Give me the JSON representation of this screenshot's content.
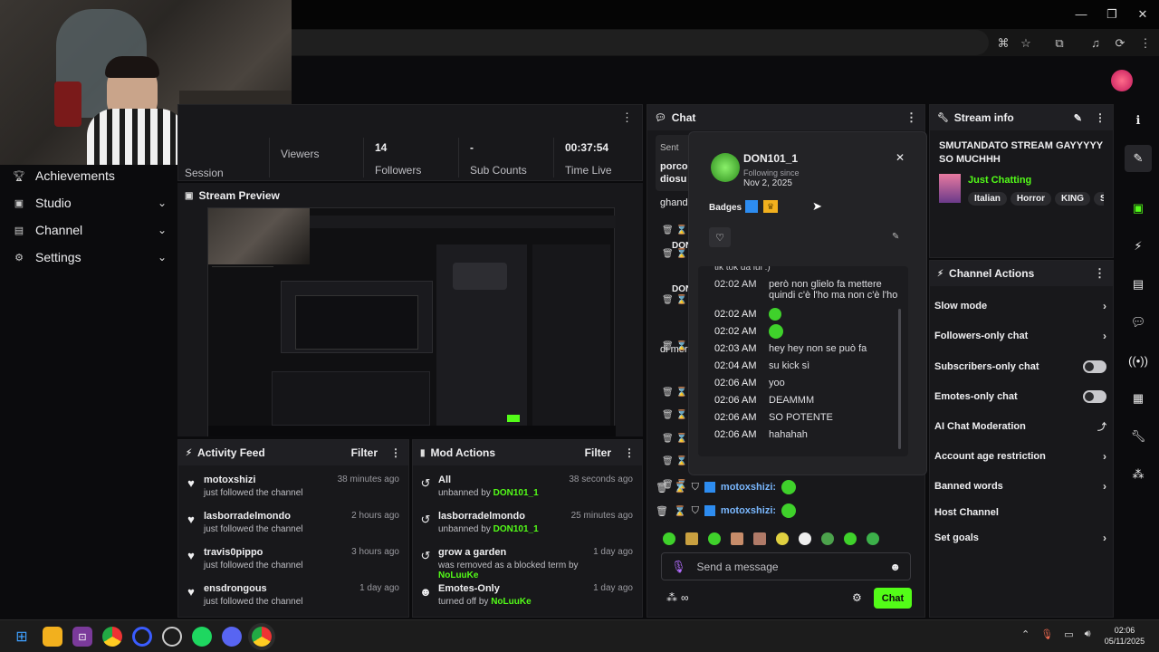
{
  "window": {
    "minimize": "—",
    "maximize": "❐",
    "close": "✕"
  },
  "toolbar_icons": [
    "translate-icon",
    "star-icon",
    "extensions-icon",
    "media-icon",
    "profile-sync-icon",
    "more-icon"
  ],
  "nav": {
    "items": [
      {
        "label": "Achievements",
        "icon": "trophy-icon"
      },
      {
        "label": "Studio",
        "icon": "studio-icon"
      },
      {
        "label": "Channel",
        "icon": "channel-icon"
      },
      {
        "label": "Settings",
        "icon": "gear-icon"
      }
    ]
  },
  "session": {
    "label": "Session",
    "stats": [
      {
        "value": "",
        "label": "Viewers"
      },
      {
        "value": "14",
        "label": "Followers"
      },
      {
        "value": "-",
        "label": "Sub Counts"
      },
      {
        "value": "00:37:54",
        "label": "Time Live"
      }
    ]
  },
  "preview": {
    "title": "Stream Preview"
  },
  "activity": {
    "title": "Activity Feed",
    "filter": "Filter",
    "items": [
      {
        "user": "motoxshizi",
        "text": "just followed the channel",
        "time": "38 minutes ago"
      },
      {
        "user": "lasborradelmondo",
        "text": "just followed the channel",
        "time": "2 hours ago"
      },
      {
        "user": "travis0pippo",
        "text": "just followed the channel",
        "time": "3 hours ago"
      },
      {
        "user": "ensdrongous",
        "text": "just followed the channel",
        "time": "1 day ago"
      }
    ]
  },
  "modactions": {
    "title": "Mod Actions",
    "filter": "Filter",
    "items": [
      {
        "target": "All",
        "action": "unbanned by ",
        "by": "DON101_1",
        "time": "38 seconds ago"
      },
      {
        "target": "lasborradelmondo",
        "action": "unbanned by ",
        "by": "DON101_1",
        "time": "25 minutes ago"
      },
      {
        "target": "grow a garden",
        "action": "was removed as a blocked term by ",
        "by": "NoLuuKe",
        "time": "1 day ago"
      },
      {
        "target": "Emotes-Only",
        "action": "turned off by ",
        "by": "NoLuuKe",
        "time": "1 day ago"
      }
    ]
  },
  "chat": {
    "title": "Chat",
    "partial": [
      "Sent",
      "porco",
      "diosu",
      "ghand",
      "DON",
      "DON",
      "di mer"
    ],
    "rows": [
      {
        "user": "motoxshizi:"
      },
      {
        "user": "motoxshizi:"
      }
    ],
    "input_placeholder": "Send a message",
    "send_label": "Chat",
    "infinity": "∞"
  },
  "popup": {
    "username": "DON101_1",
    "following_label": "Following since",
    "following_date": "Nov 2, 2025",
    "badges_label": "Badges",
    "partial_line": "tik tok da lui :)",
    "messages": [
      {
        "time": "02:02 AM",
        "text": "però non glielo fa mettere quindi c'è l'ho ma non c'è l'ho"
      },
      {
        "time": "02:02 AM",
        "text": ""
      },
      {
        "time": "02:02 AM",
        "text": ""
      },
      {
        "time": "02:03 AM",
        "text": "hey hey non se può fa"
      },
      {
        "time": "02:04 AM",
        "text": "su kick sì"
      },
      {
        "time": "02:06 AM",
        "text": "yoo"
      },
      {
        "time": "02:06 AM",
        "text": "DEAMMM"
      },
      {
        "time": "02:06 AM",
        "text": "SO POTENTE"
      },
      {
        "time": "02:06 AM",
        "text": "hahahah"
      }
    ]
  },
  "streaminfo": {
    "title": "Stream info",
    "stream_title": "SMUTANDATO STREAM GAYYYYY SO MUCHHH",
    "category": "Just Chatting",
    "tags": [
      "Italian",
      "Horror",
      "KING",
      "SIL"
    ]
  },
  "channelactions": {
    "title": "Channel Actions",
    "items": [
      {
        "label": "Slow mode",
        "control": "chevron"
      },
      {
        "label": "Followers-only chat",
        "control": "chevron"
      },
      {
        "label": "Subscribers-only chat",
        "control": "toggle"
      },
      {
        "label": "Emotes-only chat",
        "control": "toggle"
      },
      {
        "label": "AI Chat Moderation",
        "control": "external"
      },
      {
        "label": "Account age restriction",
        "control": "chevron"
      },
      {
        "label": "Banned words",
        "control": "chevron"
      },
      {
        "label": "Host Channel",
        "control": "none"
      },
      {
        "label": "Set goals",
        "control": "chevron"
      }
    ]
  },
  "taskbar": {
    "time": "02:06",
    "date": "05/11/2025"
  },
  "colors": {
    "accent": "#53fc18",
    "panel": "#18181b",
    "background": "#0b0b0d"
  }
}
